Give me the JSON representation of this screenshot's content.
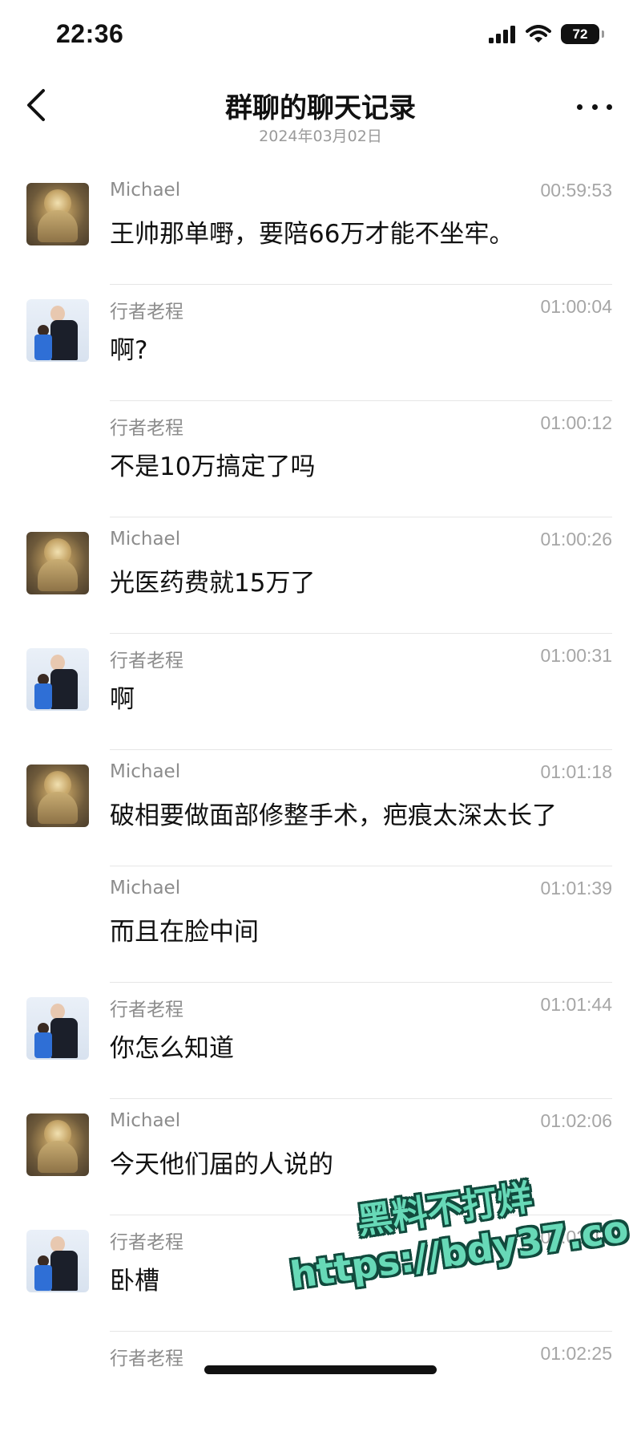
{
  "status_bar": {
    "time": "22:36",
    "battery": "72",
    "icons": [
      "signal-icon",
      "wifi-icon",
      "battery-icon"
    ]
  },
  "nav": {
    "title": "群聊的聊天记录",
    "subtitle": "2024年03月02日",
    "back_icon": "chevron-left-icon",
    "more_icon": "more-icon"
  },
  "messages": [
    {
      "sender": "Michael",
      "time": "00:59:53",
      "text": "王帅那单嘢，要陪66万才能不坐牢。",
      "avatar": "buddha"
    },
    {
      "sender": "行者老程",
      "time": "01:00:04",
      "text": "啊?",
      "avatar": "person"
    },
    {
      "sender": "行者老程",
      "time": "01:00:12",
      "text": "不是10万搞定了吗",
      "avatar": ""
    },
    {
      "sender": "Michael",
      "time": "01:00:26",
      "text": "光医药费就15万了",
      "avatar": "buddha"
    },
    {
      "sender": "行者老程",
      "time": "01:00:31",
      "text": "啊",
      "avatar": "person"
    },
    {
      "sender": "Michael",
      "time": "01:01:18",
      "text": "破相要做面部修整手术，疤痕太深太长了",
      "avatar": "buddha"
    },
    {
      "sender": "Michael",
      "time": "01:01:39",
      "text": "而且在脸中间",
      "avatar": ""
    },
    {
      "sender": "行者老程",
      "time": "01:01:44",
      "text": "你怎么知道",
      "avatar": "person"
    },
    {
      "sender": "Michael",
      "time": "01:02:06",
      "text": "今天他们届的人说的",
      "avatar": "buddha"
    },
    {
      "sender": "行者老程",
      "time": "01:02:13",
      "text": "卧槽",
      "avatar": "person"
    },
    {
      "sender": "行者老程",
      "time": "01:02:25",
      "text": "",
      "avatar": ""
    }
  ],
  "watermark": {
    "line1": "黑料不打烊",
    "line2": "https://bdy37.co"
  },
  "colors": {
    "watermark_fill": "#67d9b7",
    "watermark_stroke": "#114a3d",
    "meta_text": "#8c8c8c"
  }
}
